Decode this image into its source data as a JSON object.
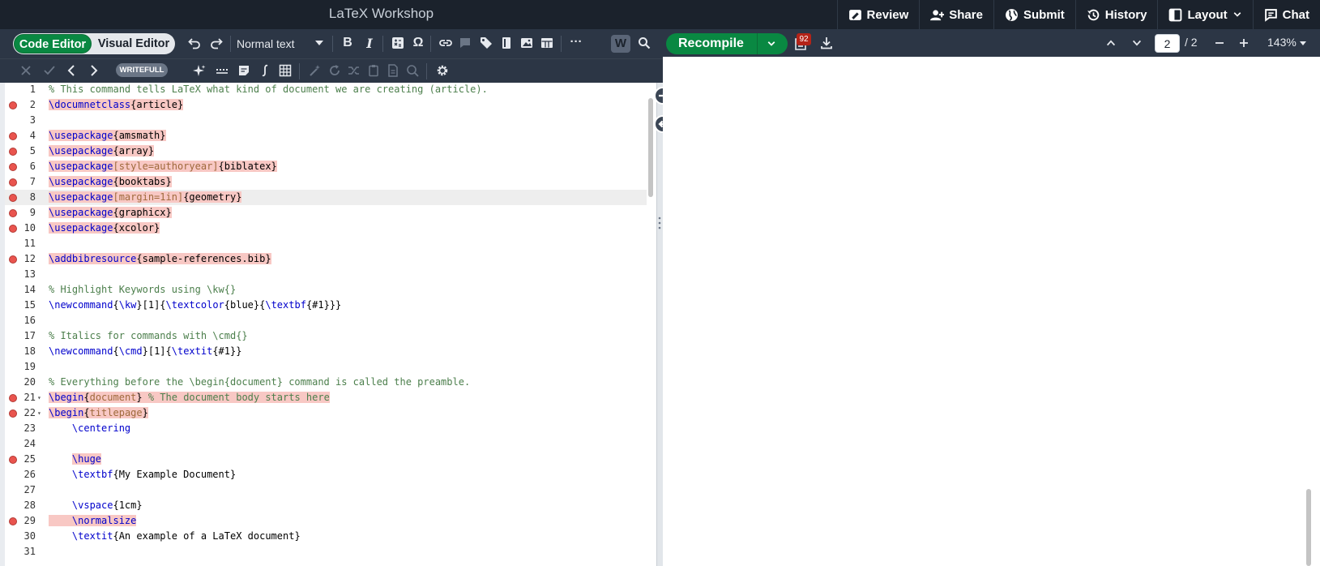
{
  "app": {
    "title": "LaTeX Workshop"
  },
  "header": {
    "actions": [
      {
        "label": "Review",
        "icon": "review-icon"
      },
      {
        "label": "Share",
        "icon": "add-user-icon"
      },
      {
        "label": "Submit",
        "icon": "globe-icon"
      },
      {
        "label": "History",
        "icon": "history-icon"
      },
      {
        "label": "Layout",
        "icon": "layout-icon"
      },
      {
        "label": "Chat",
        "icon": "chat-icon"
      }
    ]
  },
  "editor_toolbar": {
    "mode_code": "Code Editor",
    "mode_visual": "Visual Editor",
    "text_style": "Normal text",
    "bold": "B",
    "italic": "I",
    "omega": "Ω",
    "more": "···",
    "writefull": "WRITEFULL",
    "writefull_logo": "W"
  },
  "pdf_toolbar": {
    "recompile": "Recompile",
    "log_count": "92",
    "current_page": "2",
    "page_total": "/ 2",
    "zoom": "143%"
  },
  "code": {
    "lines": [
      {
        "n": "1",
        "segs": [
          [
            "c",
            "% This command tells LaTeX what kind of document we are creating (article)."
          ]
        ]
      },
      {
        "n": "2",
        "err": true,
        "segs": [
          [
            "k",
            "\\documnetclass",
            1
          ],
          [
            "t",
            "{article}",
            1
          ]
        ]
      },
      {
        "n": "3",
        "segs": []
      },
      {
        "n": "4",
        "err": true,
        "segs": [
          [
            "k",
            "\\usepackage",
            1
          ],
          [
            "t",
            "{amsmath}",
            1
          ]
        ]
      },
      {
        "n": "5",
        "err": true,
        "segs": [
          [
            "k",
            "\\usepackage",
            1
          ],
          [
            "t",
            "{array}",
            1
          ]
        ]
      },
      {
        "n": "6",
        "err": true,
        "segs": [
          [
            "k",
            "\\usepackage",
            1
          ],
          [
            "o",
            "[style=authoryear]",
            1
          ],
          [
            "t",
            "{biblatex}",
            1
          ]
        ]
      },
      {
        "n": "7",
        "err": true,
        "segs": [
          [
            "k",
            "\\usepackage",
            1
          ],
          [
            "t",
            "{booktabs}",
            1
          ]
        ]
      },
      {
        "n": "8",
        "err": true,
        "active": true,
        "segs": [
          [
            "k",
            "\\usepackage",
            1
          ],
          [
            "o",
            "[margin=1in]",
            1
          ],
          [
            "t",
            "{geometry}",
            1
          ]
        ]
      },
      {
        "n": "9",
        "err": true,
        "segs": [
          [
            "k",
            "\\usepackage",
            1
          ],
          [
            "t",
            "{graphicx}",
            1
          ]
        ]
      },
      {
        "n": "10",
        "err": true,
        "segs": [
          [
            "k",
            "\\usepackage",
            1
          ],
          [
            "t",
            "{xcolor}",
            1
          ]
        ]
      },
      {
        "n": "11",
        "segs": []
      },
      {
        "n": "12",
        "err": true,
        "segs": [
          [
            "k",
            "\\addbibresource",
            1
          ],
          [
            "t",
            "{sample-references.bib}",
            1
          ]
        ]
      },
      {
        "n": "13",
        "segs": []
      },
      {
        "n": "14",
        "segs": [
          [
            "c",
            "% Highlight Keywords using \\kw{}"
          ]
        ]
      },
      {
        "n": "15",
        "segs": [
          [
            "k",
            "\\newcommand"
          ],
          [
            "t",
            "{"
          ],
          [
            "k",
            "\\kw"
          ],
          [
            "t",
            "}[1]{"
          ],
          [
            "k",
            "\\textcolor"
          ],
          [
            "t",
            "{blue}{"
          ],
          [
            "k",
            "\\textbf"
          ],
          [
            "t",
            "{#1}}}"
          ]
        ]
      },
      {
        "n": "16",
        "segs": []
      },
      {
        "n": "17",
        "segs": [
          [
            "c",
            "% Italics for commands with \\cmd{}"
          ]
        ]
      },
      {
        "n": "18",
        "segs": [
          [
            "k",
            "\\newcommand"
          ],
          [
            "t",
            "{"
          ],
          [
            "k",
            "\\cmd"
          ],
          [
            "t",
            "}[1]{"
          ],
          [
            "k",
            "\\textit"
          ],
          [
            "t",
            "{#1}}"
          ]
        ]
      },
      {
        "n": "19",
        "segs": []
      },
      {
        "n": "20",
        "segs": [
          [
            "c",
            "% Everything before the \\begin{document} command is called the preamble."
          ]
        ]
      },
      {
        "n": "21",
        "err": true,
        "fold": true,
        "segs": [
          [
            "k",
            "\\begin",
            1
          ],
          [
            "t",
            "{",
            1
          ],
          [
            "o",
            "document",
            1
          ],
          [
            "t",
            "} ",
            1
          ],
          [
            "c",
            "% The document body starts here",
            1
          ]
        ]
      },
      {
        "n": "22",
        "err": true,
        "fold": true,
        "segs": [
          [
            "k",
            "\\begin",
            1
          ],
          [
            "t",
            "{",
            1
          ],
          [
            "o",
            "titlepage",
            1
          ],
          [
            "t",
            "}",
            1
          ]
        ]
      },
      {
        "n": "23",
        "segs": [
          [
            "t",
            "    "
          ],
          [
            "k",
            "\\centering"
          ]
        ]
      },
      {
        "n": "24",
        "segs": []
      },
      {
        "n": "25",
        "err": true,
        "segs": [
          [
            "t",
            "    "
          ],
          [
            "k",
            "\\huge",
            1
          ]
        ]
      },
      {
        "n": "26",
        "segs": [
          [
            "t",
            "    "
          ],
          [
            "k",
            "\\textbf"
          ],
          [
            "t",
            "{My Example Document}"
          ]
        ]
      },
      {
        "n": "27",
        "segs": []
      },
      {
        "n": "28",
        "segs": [
          [
            "t",
            "    "
          ],
          [
            "k",
            "\\vspace"
          ],
          [
            "t",
            "{1cm}"
          ]
        ]
      },
      {
        "n": "29",
        "err": true,
        "segs": [
          [
            "t",
            "    ",
            1
          ],
          [
            "k",
            "\\normalsize",
            1
          ]
        ]
      },
      {
        "n": "30",
        "segs": [
          [
            "t",
            "    "
          ],
          [
            "k",
            "\\textit"
          ],
          [
            "t",
            "{An example of a LaTeX document}"
          ]
        ]
      },
      {
        "n": "31",
        "segs": []
      }
    ]
  },
  "colors": {
    "accent": "#098842",
    "topbar": "#1b222c",
    "toolbar": "#2c3645",
    "error": "#e9544e"
  }
}
